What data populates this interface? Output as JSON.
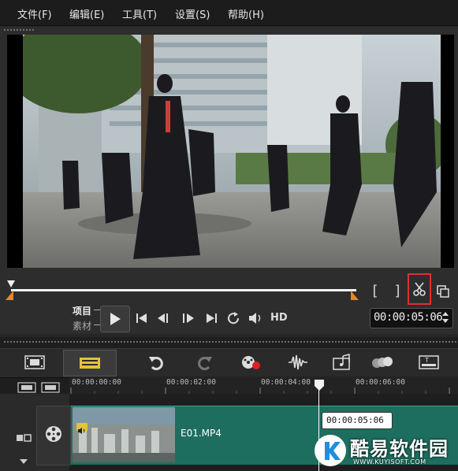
{
  "menu": {
    "items": [
      {
        "label": "文件(F)"
      },
      {
        "label": "编辑(E)"
      },
      {
        "label": "工具(T)"
      },
      {
        "label": "设置(S)"
      },
      {
        "label": "帮助(H)"
      }
    ]
  },
  "player": {
    "mode_project_label": "项目",
    "mode_clip_label": "素材",
    "hd_label": "HD",
    "timecode": "00:00:05:06",
    "seek_progress": 0.0,
    "highlight_color": "#e03030"
  },
  "timeline": {
    "ruler_labels": [
      "00:00:00:00",
      "00:00:02:00",
      "00:00:04:00",
      "00:00:06:00"
    ],
    "add_remove_label": "+/−",
    "clip_name": "E01.MP4",
    "playhead_tooltip": "00:00:05:06",
    "clip_color": "#1d6e5f"
  },
  "watermark": {
    "name": "酷易软件园",
    "url": "WWW.KUYISOFT.COM"
  }
}
